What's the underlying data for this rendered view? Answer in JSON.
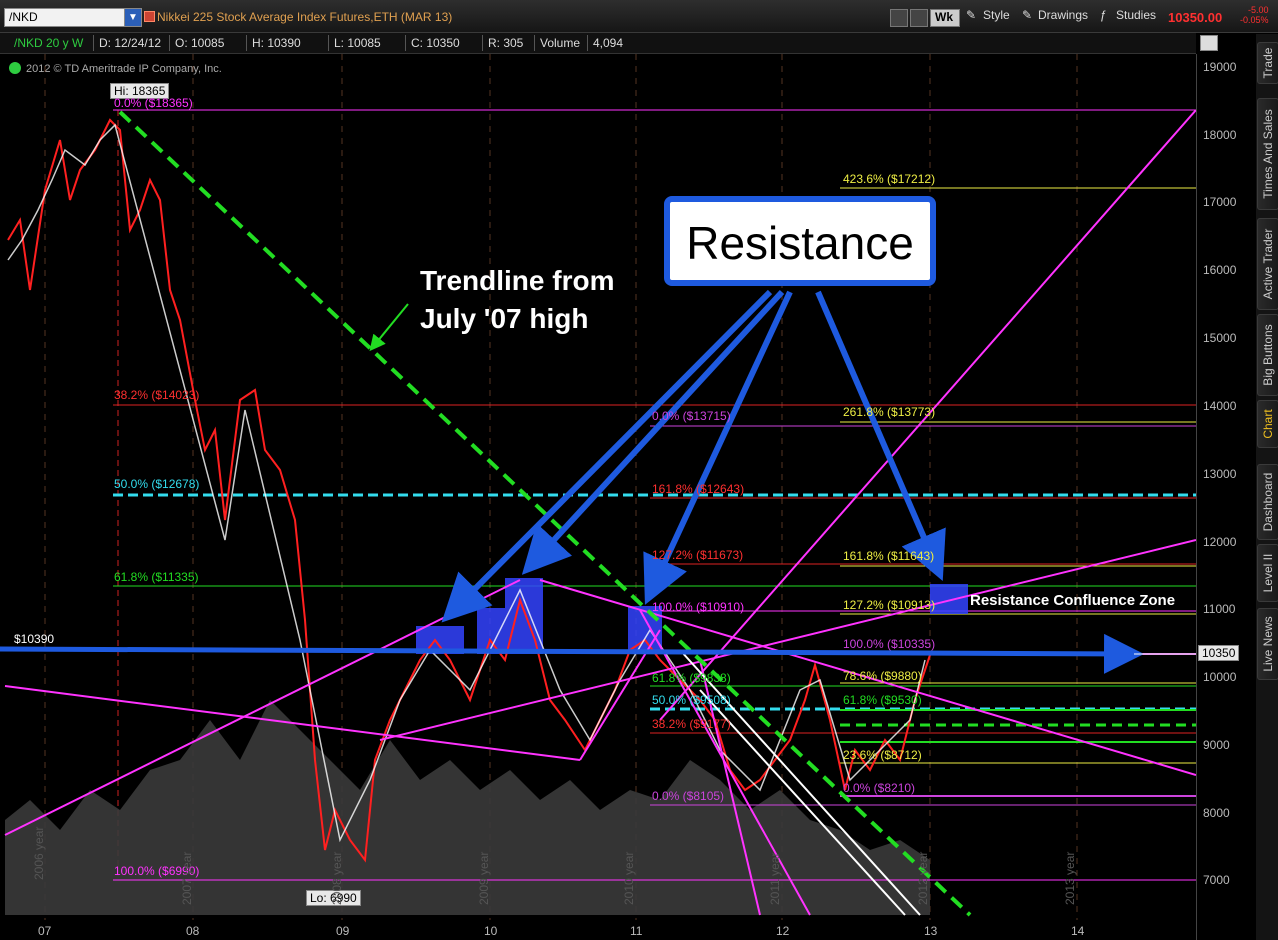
{
  "toolbar": {
    "symbol": "/NKD",
    "description": "Nikkei 225 Stock Average Index Futures,ETH (MAR 13)",
    "wk": "Wk",
    "style": "Style",
    "drawings": "Drawings",
    "studies": "Studies",
    "last": "10350.00",
    "change": "-5.00",
    "change_pct": "-0.05%"
  },
  "infobar": {
    "symbol": "/NKD 20 y W",
    "date": "D: 12/24/12",
    "open": "O: 10085",
    "high": "H: 10390",
    "low": "L: 10085",
    "close": "C: 10350",
    "range": "R: 305",
    "volume_label": "Volume",
    "volume": "4,094"
  },
  "copyright": "2012 © TD Ameritrade IP Company, Inc.",
  "side_tabs": [
    "Trade",
    "Times And Sales",
    "Active Trader",
    "Big Buttons",
    "Chart",
    "Dashboard",
    "Level II",
    "Live News"
  ],
  "side_tab_active": "Chart",
  "y_axis": [
    "19000",
    "18000",
    "17000",
    "16000",
    "15000",
    "14000",
    "13000",
    "12000",
    "11000",
    "10000",
    "9000",
    "8000",
    "7000"
  ],
  "x_axis": [
    "07",
    "08",
    "09",
    "10",
    "11",
    "12",
    "13",
    "14"
  ],
  "year_labels": [
    "2006 year",
    "2007 year",
    "2008 year",
    "2009 year",
    "2010 year",
    "2011 year",
    "2012 year",
    "2013 year"
  ],
  "tags": {
    "hi": "Hi: 18365",
    "lo": "Lo: 6990",
    "left_price": "$10390",
    "right_price": "10350"
  },
  "fib_left": {
    "top": "0.0% ($18365)",
    "f382": "38.2% ($14023)",
    "f50": "50.0% ($12678)",
    "f618": "61.8% ($11335)",
    "f100": "100.0% ($6990)"
  },
  "fib_mid": {
    "top": "0.0% ($13715)",
    "f1618": "161.8% ($12643)",
    "f1272": "127.2% ($11673)",
    "f100": "100.0% ($10910)",
    "f618": "61.8% ($9838)",
    "f50": "50.0% ($9508)",
    "f382": "38.2% ($9177)",
    "f0": "0.0% ($8105)"
  },
  "fib_right": {
    "f4236": "423.6% ($17212)",
    "f2618": "261.8% ($13773)",
    "f1618": "161.8% ($11643)",
    "f1272": "127.2% ($10913)",
    "f100": "100.0% ($10335)",
    "f786": "78.6% ($9880)",
    "f618": "61.8% ($9530)",
    "f236": "23.6% ($8712)",
    "f0": "0.0% ($8210)"
  },
  "annotations": {
    "resistance": "Resistance",
    "trendline_line1": "Trendline from",
    "trendline_line2": "July '07 high",
    "zone": "Resistance Confluence Zone"
  },
  "colors": {
    "accent_blue": "#1e5adf",
    "trend_green": "#22dd22",
    "fib_magenta": "#ff33ff",
    "price_down": "#ff2020",
    "price_up": "#ffffff"
  }
}
